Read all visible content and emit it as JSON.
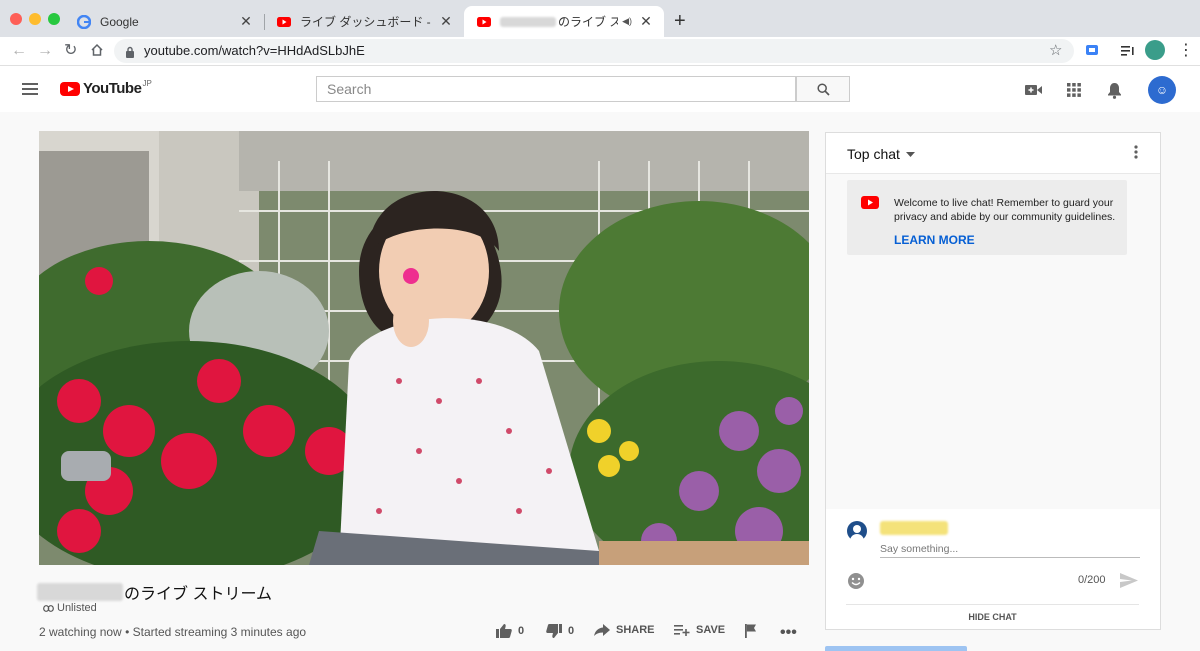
{
  "browser": {
    "tabs": [
      {
        "title": "Google"
      },
      {
        "title": "ライブ ダッシュボード - YouTube"
      },
      {
        "title": "のライブ ストリ"
      }
    ],
    "url": "youtube.com/watch?v=HHdAdSLbJhE"
  },
  "youtube": {
    "logo_text": "YouTube",
    "logo_region": "JP",
    "search_placeholder": "Search"
  },
  "video": {
    "title_suffix": "のライブ ストリーム",
    "visibility": "Unlisted",
    "watching": "2 watching now",
    "started": "Started streaming 3 minutes ago",
    "likes": "0",
    "dislikes": "0",
    "share_label": "SHARE",
    "save_label": "SAVE"
  },
  "chat": {
    "mode": "Top chat",
    "welcome": "Welcome to live chat! Remember to guard your privacy and abide by our community guidelines.",
    "learn_more": "LEARN MORE",
    "input_placeholder": "Say something...",
    "char_counter": "0/200",
    "hide_chat": "HIDE CHAT"
  },
  "colors": {
    "youtube_red": "#ff0000",
    "link_blue": "#065fd4",
    "avatar_blue": "#2d6bd0"
  }
}
